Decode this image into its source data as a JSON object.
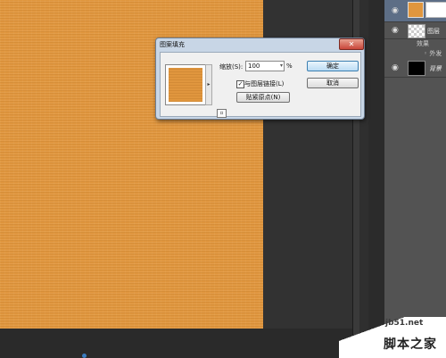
{
  "dialog": {
    "title": "图案填充",
    "close_label": "✕",
    "scale_label": "缩放(S):",
    "scale_value": "100",
    "scale_unit": "%",
    "link_checkbox_checked": true,
    "link_checkbox_mark": "✓",
    "link_label": "与图层链接(L)",
    "snap_label": "贴紧原点(N)",
    "ok_label": "确定",
    "cancel_label": "取消"
  },
  "layers": {
    "layer_1_name": "图层",
    "fx_label": "效果",
    "fx_sub_label": "◦ 外发",
    "background_name": "背景",
    "eye_glyph": "◉"
  },
  "watermark": {
    "url": "jb51.net",
    "brand": "脚本之家"
  },
  "colors": {
    "pattern_fill": "#e0963e",
    "workspace": "#323232",
    "dialog_frame": "#c8d6e6",
    "close_button": "#c9463a",
    "selected_layer": "#5d6e86"
  }
}
